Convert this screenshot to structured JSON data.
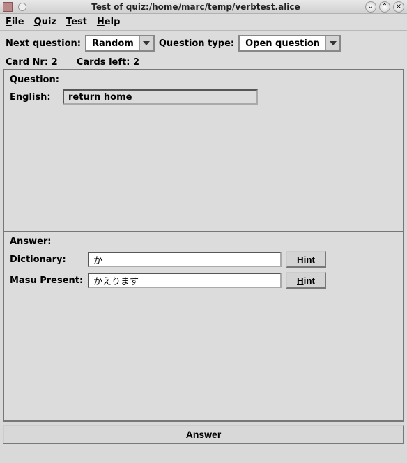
{
  "window": {
    "title": "Test of quiz:/home/marc/temp/verbtest.alice"
  },
  "menubar": {
    "file": "File",
    "quiz": "Quiz",
    "test": "Test",
    "help": "Help"
  },
  "toolbar": {
    "next_question_label": "Next question:",
    "next_question_value": "Random",
    "question_type_label": "Question type:",
    "question_type_value": "Open question"
  },
  "status": {
    "card_nr_label": "Card Nr:",
    "card_nr_value": "2",
    "cards_left_label": "Cards left:",
    "cards_left_value": "2"
  },
  "question": {
    "heading": "Question:",
    "english_label": "English:",
    "english_value": "return home"
  },
  "answer": {
    "heading": "Answer:",
    "dictionary_label": "Dictionary:",
    "dictionary_value": "か",
    "masu_label": "Masu Present:",
    "masu_value": "かえります",
    "hint_label": "Hint"
  },
  "buttons": {
    "answer": "Answer"
  }
}
